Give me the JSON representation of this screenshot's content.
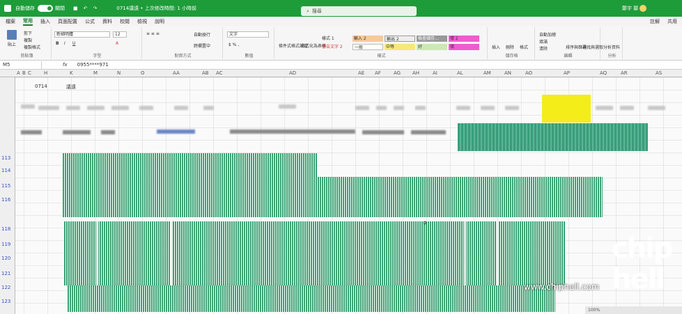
{
  "titlebar": {
    "autosave_label": "自動儲存",
    "autosave_state": "關閉",
    "doc_title": "0714議遠 • 上次修改時間: 1 小時前",
    "search_placeholder": "搜尋",
    "user": "鄭宇 鄒"
  },
  "menu": {
    "tabs": [
      "檔案",
      "常用",
      "插入",
      "頁面配置",
      "公式",
      "資料",
      "校閱",
      "檢視",
      "說明"
    ],
    "comment": "註解",
    "share": "共用"
  },
  "ribbon": {
    "clipboard": {
      "label": "剪貼簿",
      "paste": "貼上",
      "cut": "剪下",
      "copy": "複製",
      "format_painter": "複製格式"
    },
    "font": {
      "label": "字型",
      "font_name": "新細明體",
      "size": "12"
    },
    "alignment": {
      "label": "對齊方式",
      "wrap": "自動換行",
      "merge": "跨欄置中"
    },
    "number": {
      "label": "數值",
      "format": "文字"
    },
    "styles": {
      "label": "樣式",
      "cond_format": "條件式格式設定",
      "table_format": "格式化為表格",
      "style1": "樣式 1",
      "warn": "警告文字 2",
      "input2": "輸入 2",
      "output2": "輸出 2",
      "check": "檢查儲存...",
      "normal": "一般",
      "neutral": "中等",
      "good": "好",
      "bad2": "壞 2",
      "bad": "壞"
    },
    "cells": {
      "label": "儲存格",
      "insert": "插入",
      "delete": "刪除",
      "format": "格式"
    },
    "editing": {
      "label": "編輯",
      "autosum": "自動加總",
      "fill": "填滿",
      "clear": "清除",
      "sort": "排序與篩選",
      "find": "尋找與選取"
    },
    "analysis": {
      "label": "分析",
      "analyze": "分析資料"
    }
  },
  "formula": {
    "namebox": "M5",
    "fx": "fx",
    "value": "0955****971"
  },
  "columns": [
    "A",
    "B",
    "C",
    "H",
    "K",
    "M",
    "N",
    "O",
    "AA",
    "AB",
    "AC",
    "AD",
    "AE",
    "AF",
    "AG",
    "AH",
    "AI",
    "AL",
    "AM",
    "AN",
    "AO",
    "AP",
    "AQ",
    "AR",
    "AS"
  ],
  "rows": [
    "113",
    "114",
    "115",
    "116",
    "118",
    "119",
    "120",
    "121",
    "122",
    "123"
  ],
  "cells": {
    "h": "0714",
    "k": "議遠"
  },
  "watermark": "www.chiphell.com",
  "logo": "chip hell",
  "status": "100%"
}
